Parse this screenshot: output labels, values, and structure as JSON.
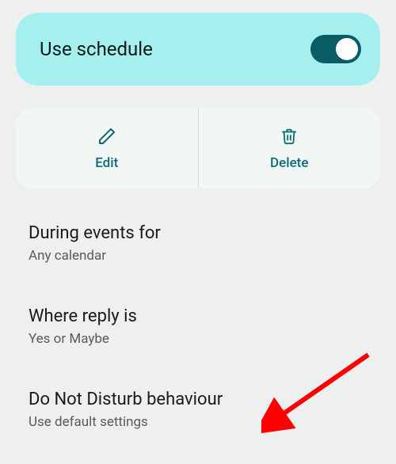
{
  "schedule": {
    "label": "Use schedule",
    "enabled": true
  },
  "actions": {
    "edit": {
      "label": "Edit",
      "icon": "pencil-icon"
    },
    "delete": {
      "label": "Delete",
      "icon": "trash-icon"
    }
  },
  "settings": [
    {
      "title": "During events for",
      "subtitle": "Any calendar"
    },
    {
      "title": "Where reply is",
      "subtitle": "Yes or Maybe"
    },
    {
      "title": "Do Not Disturb behaviour",
      "subtitle": "Use default settings"
    }
  ],
  "annotation": {
    "type": "arrow",
    "target": "settings.2"
  },
  "colors": {
    "accent_bg": "#a5efef",
    "accent_fg": "#0a5c64",
    "action_fg": "#0b6d73",
    "page_bg": "#eef0ef"
  }
}
